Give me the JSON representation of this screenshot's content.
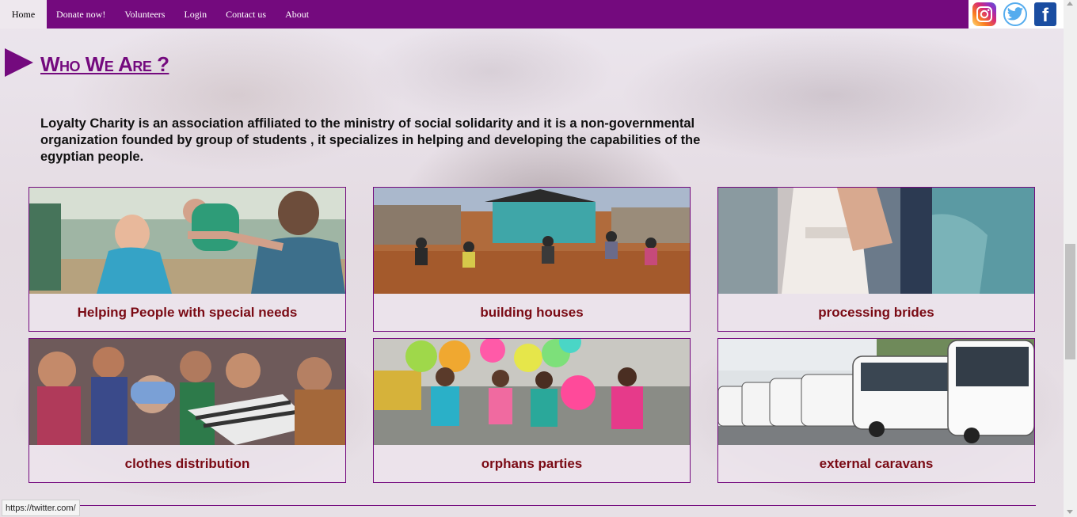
{
  "nav": {
    "items": [
      "Home",
      "Donate now!",
      "Volunteers",
      "Login",
      "Contact us",
      "About"
    ]
  },
  "social": {
    "instagram": "instagram-icon",
    "twitter": "twitter-icon",
    "facebook": "f"
  },
  "colors": {
    "brand": "#740a7e",
    "caption": "#7a0a14"
  },
  "about": {
    "title": "Who We Are ?",
    "text": "Loyalty Charity is an association affiliated to the ministry of social solidarity and it is a non-governmental organization founded by group of students , it specializes in helping and developing the capabilities of the egyptian people."
  },
  "cards": [
    {
      "caption": "Helping People with special needs"
    },
    {
      "caption": "building houses"
    },
    {
      "caption": "processing brides"
    },
    {
      "caption": "clothes distribution"
    },
    {
      "caption": "orphans parties"
    },
    {
      "caption": "external caravans"
    }
  ],
  "status_bar": {
    "url": "https://twitter.com/"
  }
}
